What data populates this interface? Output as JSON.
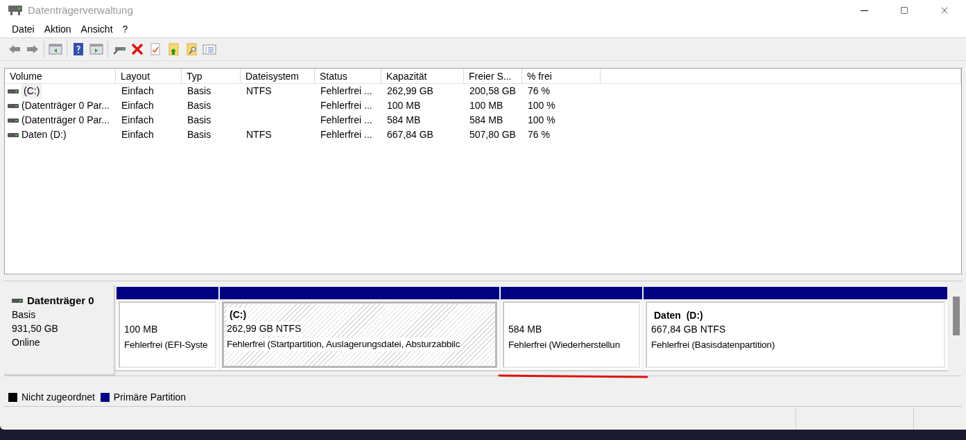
{
  "window": {
    "title": "Datenträgerverwaltung"
  },
  "menu": [
    "Datei",
    "Aktion",
    "Ansicht",
    "?"
  ],
  "table": {
    "columns": [
      "Volume",
      "Layout",
      "Typ",
      "Dateisystem",
      "Status",
      "Kapazität",
      "Freier S...",
      "% frei"
    ],
    "rows": [
      {
        "selected": true,
        "cells": [
          "(C:)",
          "Einfach",
          "Basis",
          "NTFS",
          "Fehlerfrei ...",
          "262,99 GB",
          "200,58 GB",
          "76 %"
        ]
      },
      {
        "selected": false,
        "cells": [
          "(Datenträger 0 Par...",
          "Einfach",
          "Basis",
          "",
          "Fehlerfrei ...",
          "100 MB",
          "100 MB",
          "100 %"
        ]
      },
      {
        "selected": false,
        "cells": [
          "(Datenträger 0 Par...",
          "Einfach",
          "Basis",
          "",
          "Fehlerfrei ...",
          "584 MB",
          "584 MB",
          "100 %"
        ]
      },
      {
        "selected": false,
        "cells": [
          "Daten (D:)",
          "Einfach",
          "Basis",
          "NTFS",
          "Fehlerfrei ...",
          "667,84 GB",
          "507,80 GB",
          "76 %"
        ]
      }
    ]
  },
  "disk": {
    "name": "Datenträger 0",
    "type": "Basis",
    "size": "931,50 GB",
    "state": "Online",
    "partitions": [
      {
        "selected": false,
        "color": "#000080",
        "size": "100 MB",
        "status": "Fehlerfrei (EFI-Syste"
      },
      {
        "selected": true,
        "color": "#000080",
        "name": "(C:)",
        "size": "262,99 GB NTFS",
        "status": "Fehlerfrei (Startpartition, Auslagerungsdatei, Absturzabbilc"
      },
      {
        "selected": false,
        "color": "#000080",
        "size": "584 MB",
        "status": "Fehlerfrei (Wiederherstellun"
      },
      {
        "selected": false,
        "color": "#000080",
        "name": "Daten  (D:)",
        "size": "667,84 GB NTFS",
        "status": "Fehlerfrei (Basisdatenpartition)"
      }
    ]
  },
  "legend": [
    {
      "label": "Nicht zugeordnet",
      "color": "#000000"
    },
    {
      "label": "Primäre Partition",
      "color": "#000080"
    }
  ]
}
